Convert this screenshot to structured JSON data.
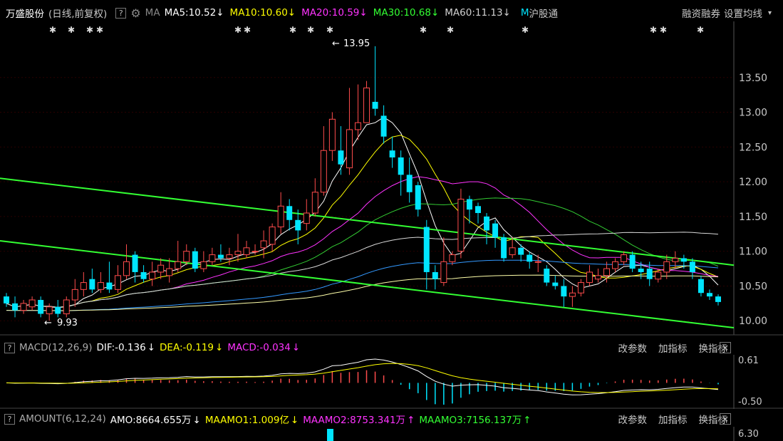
{
  "header": {
    "stock_name": "万盛股份",
    "mode": "(日线,前复权)",
    "help": "?",
    "indicator": "MA",
    "ma": [
      {
        "label": "MA5:10.52",
        "arrow": "↓",
        "color": "#ffffff"
      },
      {
        "label": "MA10:10.60",
        "arrow": "↓",
        "color": "#ffff00"
      },
      {
        "label": "MA20:10.59",
        "arrow": "↓",
        "color": "#ff33ff"
      },
      {
        "label": "MA30:10.68",
        "arrow": "↓",
        "color": "#33ff33"
      },
      {
        "label": "MA60:11.13",
        "arrow": "↓",
        "color": "#d0d0d0"
      }
    ],
    "m_tag": "M",
    "links": [
      "沪股通",
      "融资融券",
      "设置均线"
    ],
    "dropdown_arrow": "▾"
  },
  "price_axis": {
    "ticks": [
      "13.50",
      "13.00",
      "12.50",
      "12.00",
      "11.50",
      "11.00",
      "10.50",
      "10.00"
    ]
  },
  "annotations": {
    "high": "13.95",
    "low": "9.93",
    "high_arrow": "←",
    "low_arrow": "←"
  },
  "macd_panel": {
    "help": "?",
    "name": "MACD(12,26,9)",
    "dif": "DIF:-0.136",
    "dif_arrow": "↓",
    "dea": "DEA:-0.119",
    "dea_arrow": "↓",
    "macd": "MACD:-0.034",
    "macd_arrow": "↓",
    "links": [
      "改参数",
      "加指标",
      "换指标"
    ],
    "close": "×",
    "ticks": [
      "0.61",
      "-0.50"
    ]
  },
  "amount_panel": {
    "help": "?",
    "name": "AMOUNT(6,12,24)",
    "amo": "AMO:8664.655万",
    "amo_arrow": "↓",
    "m1": "MAAMO1:1.009亿",
    "m1_arrow": "↓",
    "m2": "MAAMO2:8753.341万",
    "m2_arrow": "↑",
    "m3": "MAAMO3:7156.137万",
    "m3_arrow": "↑",
    "links": [
      "改参数",
      "加指标",
      "换指标"
    ],
    "close": "×",
    "ticks": [
      "6.30"
    ]
  },
  "colors": {
    "up": "#ff4c4c",
    "down": "#00e5ff",
    "trend": "#33ff33",
    "ma5": "#ffffff",
    "ma10": "#ffff00",
    "ma20": "#ff33ff",
    "ma30": "#33cc33",
    "ma60": "#d8d8d8",
    "ma120": "#3399ff",
    "ma250": "#ffffaa"
  },
  "chart_data": {
    "type": "candlestick",
    "y_range": [
      9.9,
      14.0
    ],
    "candles": [
      [
        10.35,
        10.25,
        10.4,
        10.2
      ],
      [
        10.25,
        10.15,
        10.35,
        10.05
      ],
      [
        10.15,
        10.25,
        10.3,
        10.1
      ],
      [
        10.2,
        10.3,
        10.35,
        10.15
      ],
      [
        10.3,
        10.1,
        10.35,
        10.05
      ],
      [
        10.1,
        10.2,
        10.25,
        10.0
      ],
      [
        10.2,
        10.1,
        10.3,
        10.05
      ],
      [
        10.1,
        10.3,
        10.35,
        10.05
      ],
      [
        10.3,
        10.45,
        10.6,
        10.2
      ],
      [
        10.45,
        10.55,
        10.7,
        10.35
      ],
      [
        10.6,
        10.45,
        10.75,
        10.4
      ],
      [
        10.45,
        10.55,
        10.7,
        10.4
      ],
      [
        10.55,
        10.45,
        10.85,
        10.4
      ],
      [
        10.45,
        10.65,
        10.8,
        10.4
      ],
      [
        10.65,
        10.85,
        11.1,
        10.6
      ],
      [
        10.95,
        10.7,
        11.0,
        10.55
      ],
      [
        10.7,
        10.6,
        10.8,
        10.55
      ],
      [
        10.6,
        10.7,
        10.85,
        10.5
      ],
      [
        10.7,
        10.8,
        10.9,
        10.6
      ],
      [
        10.65,
        10.75,
        10.9,
        10.55
      ],
      [
        10.75,
        10.85,
        11.15,
        10.7
      ],
      [
        10.85,
        11.0,
        11.1,
        10.8
      ],
      [
        11.0,
        10.75,
        11.05,
        10.7
      ],
      [
        10.75,
        10.85,
        11.0,
        10.7
      ],
      [
        10.85,
        10.95,
        11.05,
        10.8
      ],
      [
        10.95,
        10.9,
        11.1,
        10.85
      ],
      [
        10.9,
        10.95,
        11.05,
        10.8
      ],
      [
        10.95,
        11.0,
        11.25,
        10.85
      ],
      [
        10.95,
        11.05,
        11.15,
        10.9
      ],
      [
        11.0,
        11.0,
        11.1,
        10.95
      ],
      [
        11.05,
        11.15,
        11.3,
        10.9
      ],
      [
        11.1,
        11.35,
        11.4,
        11.0
      ],
      [
        11.35,
        11.65,
        11.85,
        11.25
      ],
      [
        11.65,
        11.45,
        11.75,
        11.3
      ],
      [
        11.45,
        11.3,
        11.6,
        11.1
      ],
      [
        11.4,
        11.55,
        11.75,
        11.3
      ],
      [
        11.55,
        11.85,
        12.05,
        11.5
      ],
      [
        11.85,
        12.45,
        12.8,
        11.8
      ],
      [
        12.45,
        12.9,
        13.0,
        12.3
      ],
      [
        12.45,
        12.25,
        12.8,
        12.1
      ],
      [
        12.2,
        12.75,
        13.35,
        12.1
      ],
      [
        12.75,
        12.85,
        13.4,
        12.6
      ],
      [
        12.85,
        13.35,
        13.45,
        12.85
      ],
      [
        13.15,
        13.05,
        13.95,
        12.95
      ],
      [
        12.95,
        12.65,
        13.1,
        12.55
      ],
      [
        12.45,
        12.35,
        12.65,
        12.2
      ],
      [
        12.35,
        12.1,
        12.45,
        11.8
      ],
      [
        12.1,
        11.85,
        12.35,
        11.7
      ],
      [
        11.95,
        11.6,
        12.0,
        11.5
      ],
      [
        11.35,
        10.7,
        11.45,
        10.45
      ],
      [
        10.7,
        10.6,
        10.8,
        10.45
      ],
      [
        10.55,
        10.85,
        11.2,
        10.5
      ],
      [
        10.85,
        10.95,
        11.0,
        10.8
      ],
      [
        11.0,
        11.75,
        11.9,
        10.9
      ],
      [
        11.75,
        11.6,
        11.8,
        11.4
      ],
      [
        11.65,
        11.55,
        11.7,
        11.4
      ],
      [
        11.5,
        11.3,
        11.55,
        11.1
      ],
      [
        11.4,
        11.2,
        11.45,
        11.05
      ],
      [
        11.2,
        10.9,
        11.25,
        10.85
      ],
      [
        10.95,
        11.05,
        11.2,
        10.9
      ],
      [
        11.05,
        10.95,
        11.1,
        10.85
      ],
      [
        10.95,
        10.85,
        11.0,
        10.75
      ],
      [
        10.85,
        10.85,
        10.95,
        10.7
      ],
      [
        10.75,
        10.55,
        10.8,
        10.5
      ],
      [
        10.55,
        10.5,
        10.65,
        10.45
      ],
      [
        10.5,
        10.35,
        10.6,
        10.2
      ],
      [
        10.35,
        10.4,
        10.5,
        10.2
      ],
      [
        10.4,
        10.55,
        10.6,
        10.35
      ],
      [
        10.55,
        10.7,
        10.8,
        10.5
      ],
      [
        10.6,
        10.65,
        10.75,
        10.55
      ],
      [
        10.65,
        10.75,
        10.85,
        10.55
      ],
      [
        10.75,
        10.85,
        10.9,
        10.7
      ],
      [
        10.85,
        10.95,
        11.0,
        10.8
      ],
      [
        10.95,
        10.75,
        11.0,
        10.7
      ],
      [
        10.75,
        10.7,
        10.85,
        10.6
      ],
      [
        10.75,
        10.6,
        10.85,
        10.5
      ],
      [
        10.6,
        10.7,
        10.75,
        10.55
      ],
      [
        10.7,
        10.85,
        10.95,
        10.6
      ],
      [
        10.85,
        10.9,
        11.0,
        10.75
      ],
      [
        10.9,
        10.85,
        10.95,
        10.75
      ],
      [
        10.85,
        10.7,
        10.9,
        10.6
      ],
      [
        10.6,
        10.4,
        10.65,
        10.35
      ],
      [
        10.4,
        10.35,
        10.45,
        10.3
      ],
      [
        10.35,
        10.27,
        10.38,
        10.22
      ]
    ],
    "trendlines": [
      {
        "from": [
          0,
          12.05
        ],
        "to": [
          83,
          10.8
        ]
      },
      {
        "from": [
          0,
          11.15
        ],
        "to": [
          83,
          9.9
        ]
      }
    ]
  }
}
